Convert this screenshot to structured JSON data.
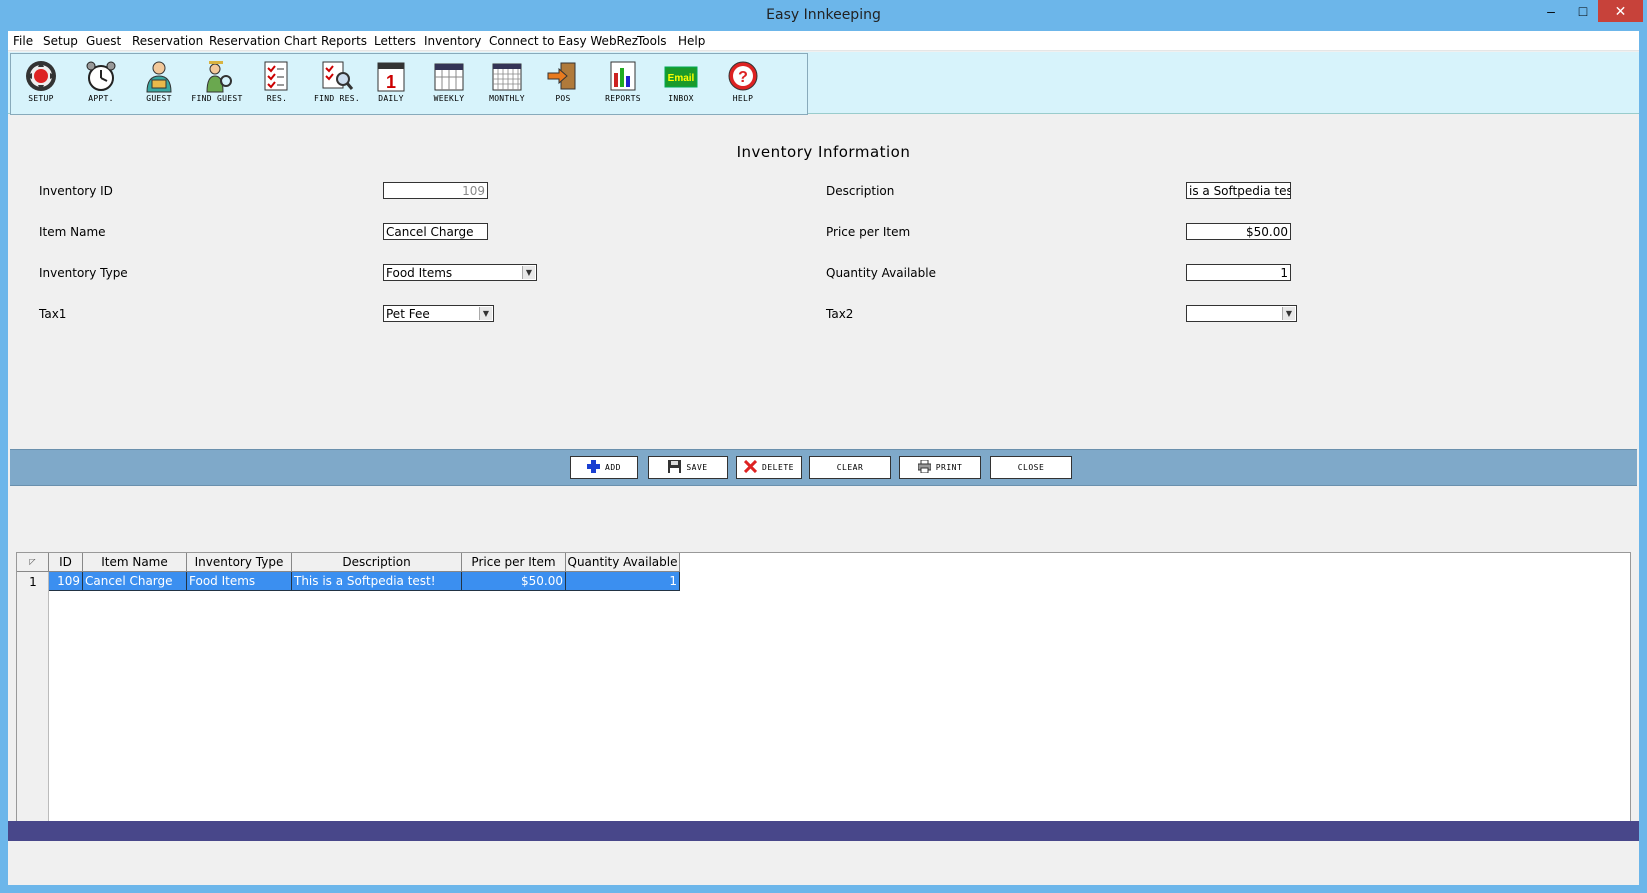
{
  "window": {
    "title": "Easy Innkeeping",
    "min": "‒",
    "max": "□",
    "close": "✕"
  },
  "menu": [
    "File",
    "Setup",
    "Guest",
    "Reservation",
    "Reservation Chart",
    "Reports",
    "Letters",
    "Inventory",
    "Connect to Easy WebRez",
    "Tools",
    "Help"
  ],
  "toolbar": [
    {
      "label": "SETUP",
      "icon": "setup-icon"
    },
    {
      "label": "APPT.",
      "icon": "alarm-clock-icon"
    },
    {
      "label": "GUEST",
      "icon": "guest-icon"
    },
    {
      "label": "FIND GUEST",
      "icon": "find-guest-icon"
    },
    {
      "label": "RES.",
      "icon": "reservation-icon"
    },
    {
      "label": "FIND RES.",
      "icon": "find-reservation-icon"
    },
    {
      "label": "DAILY",
      "icon": "daily-calendar-icon"
    },
    {
      "label": "WEEKLY",
      "icon": "weekly-calendar-icon"
    },
    {
      "label": "MONTHLY",
      "icon": "monthly-calendar-icon"
    },
    {
      "label": "POS",
      "icon": "pos-icon"
    },
    {
      "label": "REPORTS",
      "icon": "reports-icon"
    },
    {
      "label": "INBOX",
      "icon": "email-icon",
      "icon_text": "Email"
    },
    {
      "label": "HELP",
      "icon": "help-icon"
    }
  ],
  "form": {
    "title": "Inventory Information",
    "inventory_id_label": "Inventory ID",
    "inventory_id": "109",
    "item_name_label": "Item Name",
    "item_name": "Cancel Charge",
    "inventory_type_label": "Inventory Type",
    "inventory_type": "Food Items",
    "tax1_label": "Tax1",
    "tax1": "Pet Fee",
    "description_label": "Description",
    "description": "is a Softpedia test!",
    "price_label": "Price per Item",
    "price": "$50.00",
    "quantity_label": "Quantity Available",
    "quantity": "1",
    "tax2_label": "Tax2",
    "tax2": ""
  },
  "actions": {
    "add": "ADD",
    "save": "SAVE",
    "delete": "DELETE",
    "clear": "CLEAR",
    "print": "PRINT",
    "close": "CLOSE"
  },
  "grid": {
    "columns": [
      "ID",
      "Item Name",
      "Inventory Type",
      "Description",
      "Price per Item",
      "Quantity Available"
    ],
    "rows": [
      {
        "num": "1",
        "id": "109",
        "item_name": "Cancel Charge",
        "inventory_type": "Food Items",
        "description": "This is a Softpedia test!",
        "price": "$50.00",
        "quantity": "1"
      }
    ]
  },
  "colors": {
    "selection": "#3b8ff0",
    "actionbar": "#7fa9c9",
    "statusbar": "#48478a",
    "toolbar": "#d7f3fb"
  }
}
